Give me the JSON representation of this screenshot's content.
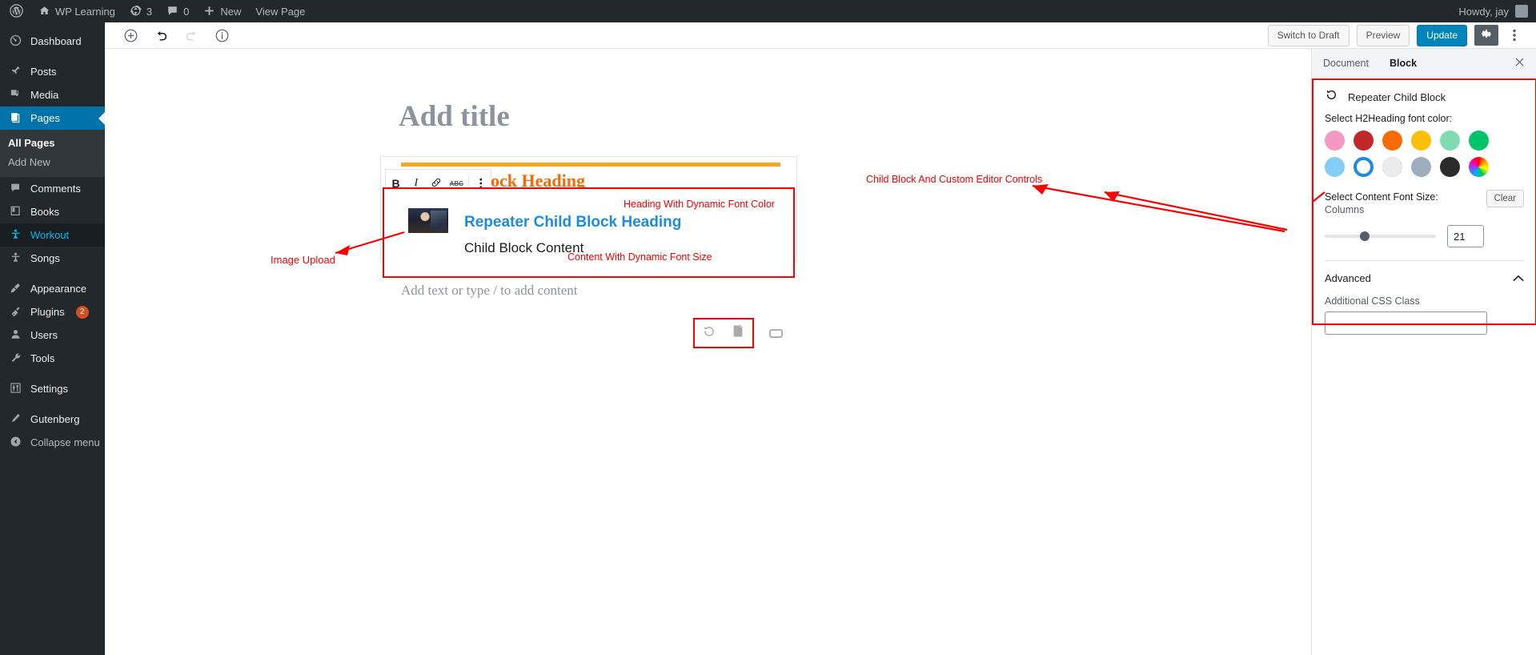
{
  "adminbar": {
    "logo_icon": "wordpress-icon",
    "site_icon": "home-icon",
    "site_name": "WP Learning",
    "updates_icon": "updates-icon",
    "updates_count": "3",
    "comments_icon": "comment-icon",
    "comments_count": "0",
    "new_icon": "plus-icon",
    "new_label": "New",
    "view_page_label": "View Page",
    "howdy": "Howdy, jay"
  },
  "sidebar": {
    "items": [
      {
        "label": "Dashboard",
        "icon": "dashboard-icon",
        "state": "normal"
      },
      {
        "label": "Posts",
        "icon": "pin-icon",
        "state": "normal"
      },
      {
        "label": "Media",
        "icon": "media-icon",
        "state": "normal"
      },
      {
        "label": "Pages",
        "icon": "page-icon",
        "state": "current"
      },
      {
        "label": "Comments",
        "icon": "comment-icon",
        "state": "normal"
      },
      {
        "label": "Books",
        "icon": "book-icon",
        "state": "normal"
      },
      {
        "label": "Workout",
        "icon": "person-icon",
        "state": "highlight"
      },
      {
        "label": "Songs",
        "icon": "person-icon",
        "state": "normal"
      },
      {
        "label": "Appearance",
        "icon": "brush-icon",
        "state": "normal"
      },
      {
        "label": "Plugins",
        "icon": "plugin-icon",
        "state": "normal",
        "badge": "2"
      },
      {
        "label": "Users",
        "icon": "user-icon",
        "state": "normal"
      },
      {
        "label": "Tools",
        "icon": "wrench-icon",
        "state": "normal"
      },
      {
        "label": "Settings",
        "icon": "sliders-icon",
        "state": "normal"
      },
      {
        "label": "Gutenberg",
        "icon": "pencil-icon",
        "state": "normal"
      },
      {
        "label": "Collapse menu",
        "icon": "collapse-icon",
        "state": "collapse"
      }
    ],
    "submenu": [
      {
        "label": "All Pages",
        "active": true
      },
      {
        "label": "Add New",
        "active": false
      }
    ]
  },
  "editor_toolbar": {
    "add_block_icon": "plus-circle-icon",
    "undo_icon": "undo-icon",
    "redo_icon": "redo-icon",
    "info_icon": "info-icon",
    "switch_to_draft": "Switch to Draft",
    "preview": "Preview",
    "update": "Update",
    "settings_icon": "gear-icon",
    "more_icon": "kebab-menu-icon"
  },
  "canvas": {
    "title_placeholder": "Add title",
    "parent_heading": "ock Heading",
    "block_toolbar": {
      "bold": "B",
      "italic": "I",
      "link_icon": "link-icon",
      "strikethrough": "ABC",
      "more_icon": "kebab-menu-icon"
    },
    "child_block": {
      "image_alt": "uploaded-image",
      "heading": "Repeater Child Block Heading",
      "content": "Child Block Content",
      "heading_color": "#1e8cde"
    },
    "paragraph_placeholder": "Add text or type / to add content",
    "bottom_tools": [
      {
        "icon": "reset-icon"
      },
      {
        "icon": "duplicate-icon"
      },
      {
        "icon": "rectangle-icon"
      }
    ]
  },
  "settings_panel": {
    "tabs": [
      {
        "label": "Document",
        "active": false
      },
      {
        "label": "Block",
        "active": true
      }
    ],
    "close_icon": "close-icon",
    "block_icon": "reset-icon",
    "block_name": "Repeater Child Block",
    "color_label": "Select H2Heading font color:",
    "colors": [
      {
        "name": "pink",
        "hex": "#f49ac1"
      },
      {
        "name": "dark-red",
        "hex": "#c0262a"
      },
      {
        "name": "orange",
        "hex": "#f76b00"
      },
      {
        "name": "yellow",
        "hex": "#fbbf07"
      },
      {
        "name": "mint",
        "hex": "#7fdcb0"
      },
      {
        "name": "green",
        "hex": "#00c46a"
      },
      {
        "name": "light-blue",
        "hex": "#83cdf7"
      },
      {
        "name": "selected-blue-ring",
        "hex": "#1e8cde"
      },
      {
        "name": "near-white",
        "hex": "#ececec"
      },
      {
        "name": "gray-blue",
        "hex": "#9dadbd"
      },
      {
        "name": "near-black",
        "hex": "#2b2b2b"
      },
      {
        "name": "rainbow",
        "hex": "rainbow"
      }
    ],
    "font_size_label": "Select Content Font Size:",
    "font_size_sub": "Columns",
    "clear_label": "Clear",
    "font_size_value": "21",
    "advanced_label": "Advanced",
    "advanced_chevron": "chevron-up-icon",
    "css_class_label": "Additional CSS Class",
    "css_class_value": ""
  },
  "annotations": {
    "image_upload": "Image Upload",
    "heading_dynamic": "Heading With Dynamic Font Color",
    "content_dynamic": "Content With Dynamic Font Size",
    "child_block_controls": "Child Block And Custom Editor Controls",
    "color": "#fa0000"
  }
}
